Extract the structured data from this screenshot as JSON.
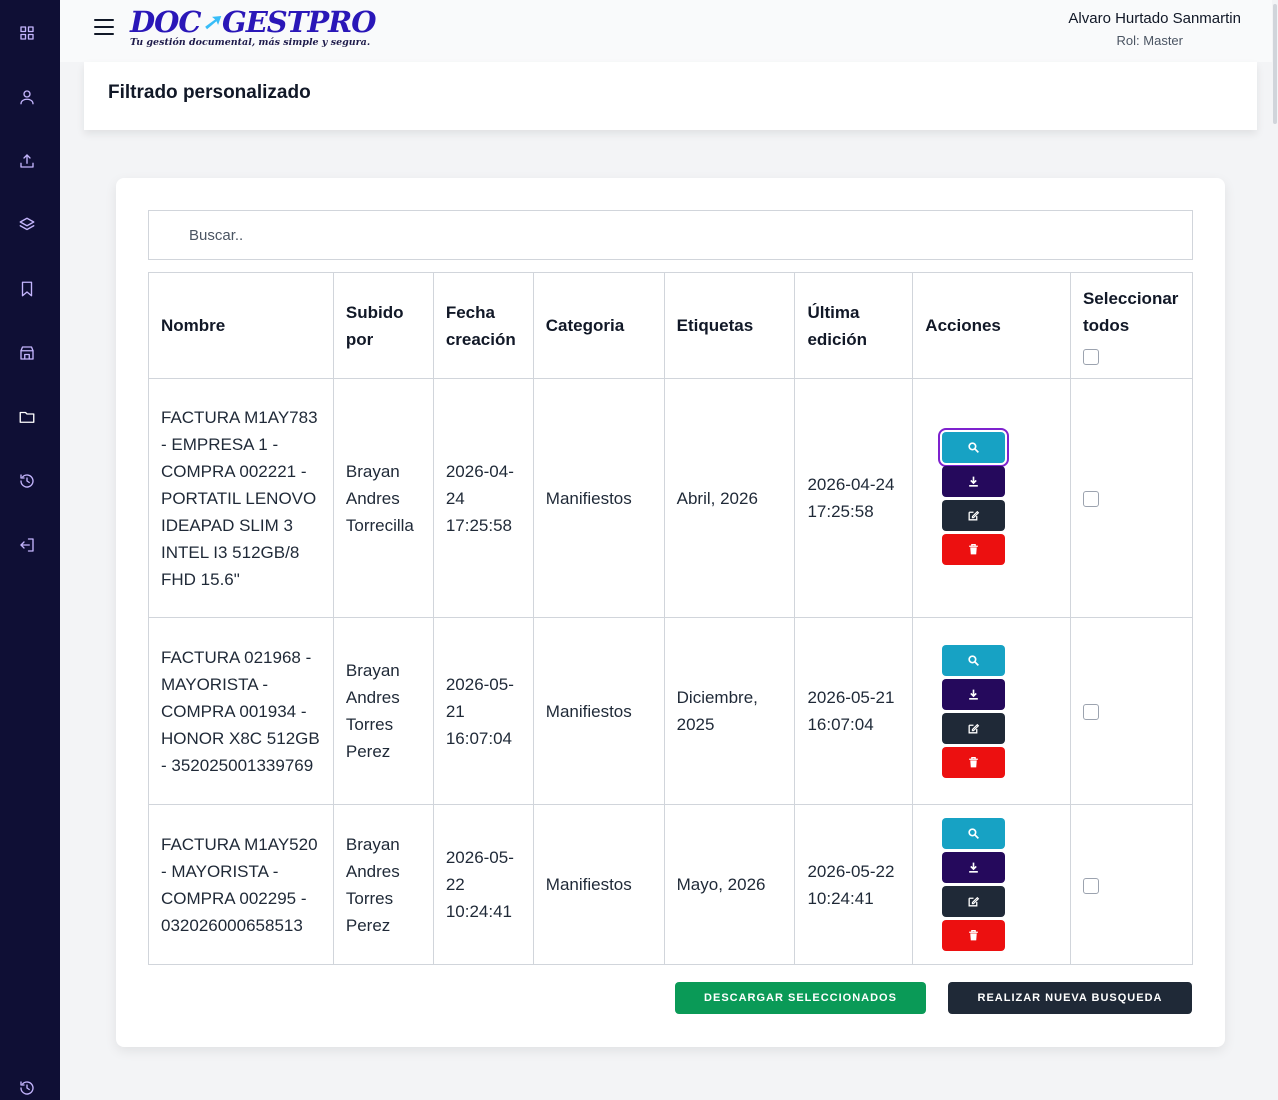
{
  "app": {
    "logo_main_left": "DOC",
    "logo_main_right": "GESTPRO",
    "logo_tagline": "Tu gestión documental, más simple y segura."
  },
  "user": {
    "name": "Alvaro Hurtado Sanmartin",
    "role": "Rol: Master"
  },
  "sidebar": {
    "items": [
      {
        "icon": "dashboard-icon"
      },
      {
        "icon": "user-icon"
      },
      {
        "icon": "upload-icon"
      },
      {
        "icon": "layers-icon"
      },
      {
        "icon": "bookmark-icon"
      },
      {
        "icon": "store-icon"
      },
      {
        "icon": "folder-icon",
        "active": true
      },
      {
        "icon": "history-icon"
      },
      {
        "icon": "logout-icon"
      },
      {
        "icon": "history-icon"
      }
    ]
  },
  "page": {
    "title": "Filtrado personalizado"
  },
  "search": {
    "placeholder": "Buscar.."
  },
  "table": {
    "headers": {
      "name": "Nombre",
      "uploaded_by": "Subido por",
      "created": "Fecha creación",
      "category": "Categoria",
      "tags": "Etiquetas",
      "edited": "Última edición",
      "actions": "Acciones",
      "select_all": "Seleccionar todos"
    },
    "rows": [
      {
        "name": "FACTURA M1AY783 - EMPRESA 1 - COMPRA 002221 - PORTATIL LENOVO IDEAPAD SLIM 3 INTEL I3 512GB/8 FHD 15.6\"",
        "uploaded_by": "Brayan Andres Torrecilla",
        "created": "2026-04-24 17:25:58",
        "category": "Manifiestos",
        "tags": "Abril, 2026",
        "edited": "2026-04-24 17:25:58"
      },
      {
        "name": "FACTURA 021968 - MAYORISTA - COMPRA 001934 - HONOR X8C 512GB - 352025001339769",
        "uploaded_by": "Brayan Andres Torres Perez",
        "created": "2026-05-21 16:07:04",
        "category": "Manifiestos",
        "tags": "Diciembre, 2025",
        "edited": "2026-05-21 16:07:04"
      },
      {
        "name": "FACTURA M1AY520 - MAYORISTA - COMPRA 002295 - 032026000658513",
        "uploaded_by": "Brayan Andres Torres Perez",
        "created": "2026-05-22 10:24:41",
        "category": "Manifiestos",
        "tags": "Mayo, 2026",
        "edited": "2026-05-22 10:24:41"
      }
    ]
  },
  "buttons": {
    "download_selected": "DESCARGAR SELECCIONADOS",
    "new_search": "REALIZAR NUEVA BUSQUEDA"
  },
  "colors": {
    "sidebar_bg": "#0f0f35",
    "view": "#17a2c4",
    "download": "#25095c",
    "edit": "#1f2937",
    "delete": "#ec1010",
    "download_selected": "#0a9a57"
  }
}
